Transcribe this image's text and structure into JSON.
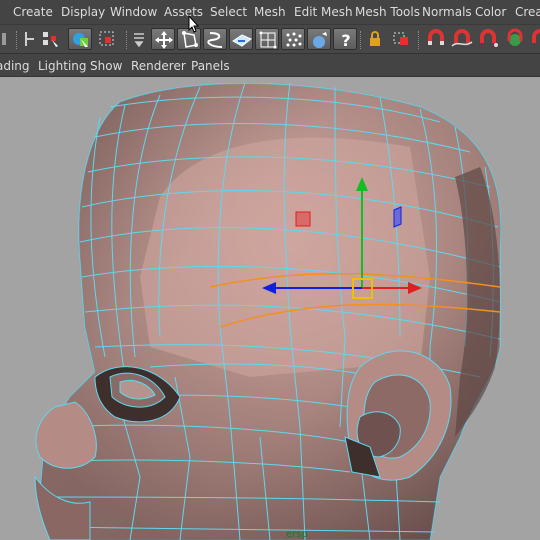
{
  "menubar": {
    "items": [
      "Create",
      "Display",
      "Window",
      "Assets",
      "Select",
      "Mesh",
      "Edit Mesh",
      "Mesh Tools",
      "Normals",
      "Color",
      "Creat"
    ]
  },
  "panelbar": {
    "items": [
      "ading",
      "Lighting",
      "Show",
      "Renderer",
      "Panels"
    ]
  },
  "viewport": {
    "camera_label": "ersp",
    "wire_color": "#5fd8f0",
    "skin_color": "#c49a93",
    "background": "#a3a3a3"
  },
  "colors": {
    "accent": "#5fd8f0",
    "axis_x": "#e02020",
    "axis_y": "#10c020",
    "axis_z": "#1020e0",
    "pivot": "#f0c000"
  },
  "shelf_icons": [
    "snap-grid-icon",
    "snap-curve-icon",
    "select-hierarchy-icon",
    "select-object-icon",
    "lasso-icon",
    "move-tool-icon",
    "poly-select-icon",
    "bridge-icon",
    "flat-shade-icon",
    "wireframe-icon",
    "smooth-icon",
    "soft-select-icon",
    "help-icon",
    "lock-icon",
    "select-component-icon",
    "magnet-snap-icon",
    "magnet-curve-icon",
    "magnet-point-icon",
    "snap-live-icon",
    "snap-plane-icon"
  ]
}
